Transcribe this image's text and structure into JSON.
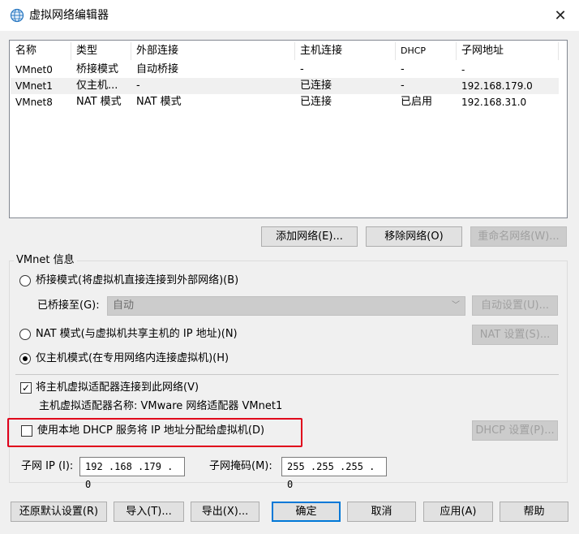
{
  "window": {
    "title": "虚拟网络编辑器",
    "close_label": "✕"
  },
  "table": {
    "headers": [
      "名称",
      "类型",
      "外部连接",
      "主机连接",
      "DHCP",
      "子网地址"
    ],
    "rows": [
      [
        "VMnet0",
        "桥接模式",
        "自动桥接",
        "-",
        "-",
        "-"
      ],
      [
        "VMnet1",
        "仅主机...",
        "-",
        "已连接",
        "-",
        "192.168.179.0"
      ],
      [
        "VMnet8",
        "NAT 模式",
        "NAT 模式",
        "已连接",
        "已启用",
        "192.168.31.0"
      ]
    ],
    "selected_row": 1
  },
  "list_buttons": {
    "add": "添加网络(E)...",
    "remove": "移除网络(O)",
    "rename": "重命名网络(W)..."
  },
  "vmnet_info": {
    "legend": "VMnet 信息",
    "bridged_label": "桥接模式(将虚拟机直接连接到外部网络)(B)",
    "bridged_to_label": "已桥接至(G):",
    "bridged_to_value": "自动",
    "auto_settings": "自动设置(U)...",
    "nat_label": "NAT 模式(与虚拟机共享主机的 IP 地址)(N)",
    "nat_settings": "NAT 设置(S)...",
    "hostonly_label": "仅主机模式(在专用网络内连接虚拟机)(H)",
    "selected_mode": "hostonly",
    "connect_adapter_label": "将主机虚拟适配器连接到此网络(V)",
    "connect_adapter_checked": true,
    "adapter_name_text": "主机虚拟适配器名称: VMware 网络适配器 VMnet1",
    "dhcp_label": "使用本地 DHCP 服务将 IP 地址分配给虚拟机(D)",
    "dhcp_checked": false,
    "dhcp_settings": "DHCP 设置(P)...",
    "subnet_ip_label": "子网 IP (I):",
    "subnet_ip_value": "192 .168 .179 . 0",
    "subnet_mask_label": "子网掩码(M):",
    "subnet_mask_value": "255 .255 .255 . 0"
  },
  "footer": {
    "restore": "还原默认设置(R)",
    "import": "导入(T)...",
    "export": "导出(X)...",
    "ok": "确定",
    "cancel": "取消",
    "apply": "应用(A)",
    "help": "帮助"
  },
  "colors": {
    "highlight": "#e0001b",
    "selection": "#f0f0f0",
    "accent": "#0078d7"
  }
}
